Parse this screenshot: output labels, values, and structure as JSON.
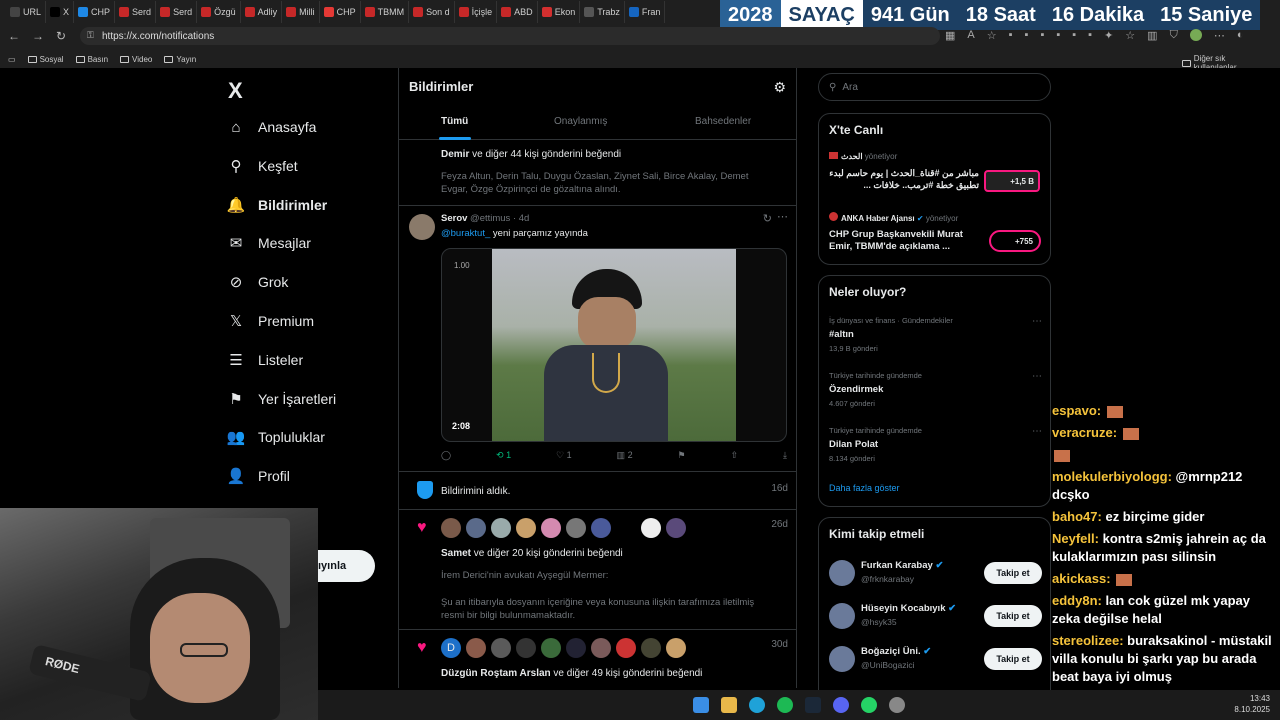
{
  "browser": {
    "tabs": [
      {
        "label": "URL",
        "color": "#444"
      },
      {
        "label": "X",
        "color": "#000"
      },
      {
        "label": "CHP",
        "color": "#1e88e5"
      },
      {
        "label": "Serd",
        "color": "#c62828"
      },
      {
        "label": "Serd",
        "color": "#c62828"
      },
      {
        "label": "Özgü",
        "color": "#c62828"
      },
      {
        "label": "Adliy",
        "color": "#c62828"
      },
      {
        "label": "Milli",
        "color": "#c62828"
      },
      {
        "label": "CHP",
        "color": "#e53935"
      },
      {
        "label": "TBMM",
        "color": "#c62828"
      },
      {
        "label": "Son d",
        "color": "#c62828"
      },
      {
        "label": "İçişle",
        "color": "#c62828"
      },
      {
        "label": "ABD",
        "color": "#c62828"
      },
      {
        "label": "Ekon",
        "color": "#d32f2f"
      },
      {
        "label": "Trabz",
        "color": "#555"
      },
      {
        "label": "Fran",
        "color": "#1565c0"
      }
    ],
    "url": "https://x.com/notifications",
    "bookmarks": [
      "Sosyal",
      "Basın",
      "Video",
      "Yayın"
    ],
    "other_bookmarks": "Diğer sık kullanılanlar"
  },
  "countdown": {
    "year": "2028",
    "label": "SAYAÇ",
    "days": "941 Gün",
    "hours": "18 Saat",
    "minutes": "16 Dakika",
    "seconds": "15 Saniye"
  },
  "sidebar": {
    "logo": "X",
    "items": [
      {
        "label": "Anasayfa",
        "icon": "home-icon",
        "glyph": "⌂"
      },
      {
        "label": "Keşfet",
        "icon": "search-icon",
        "glyph": "⚲"
      },
      {
        "label": "Bildirimler",
        "icon": "bell-icon",
        "glyph": "🔔"
      },
      {
        "label": "Mesajlar",
        "icon": "mail-icon",
        "glyph": "✉"
      },
      {
        "label": "Grok",
        "icon": "grok-icon",
        "glyph": "⊘"
      },
      {
        "label": "Premium",
        "icon": "x-premium-icon",
        "glyph": "𝕏"
      },
      {
        "label": "Listeler",
        "icon": "list-icon",
        "glyph": "☰"
      },
      {
        "label": "Yer İşaretleri",
        "icon": "bookmark-icon",
        "glyph": "⚑"
      },
      {
        "label": "Topluluklar",
        "icon": "communities-icon",
        "glyph": "👥"
      },
      {
        "label": "Profil",
        "icon": "profile-icon",
        "glyph": "👤"
      }
    ],
    "post_button": "ıyınla"
  },
  "main": {
    "title": "Bildirimler",
    "tabs": [
      "Tümü",
      "Onaylanmış",
      "Bahsedenler"
    ],
    "notif1": {
      "headline_name": "Demir",
      "headline_rest": " ve diğer 44 kişi gönderini beğendi",
      "text": "Feyza Altun, Derin Talu, Duygu Özaslan, Ziynet Sali, Birce Akalay, Demet Evgar, Özge Özpirinçci de gözaltına alındı."
    },
    "post": {
      "name": "Serov",
      "handle": "@ettimus · 4d",
      "mention": "@buraktut_",
      "text": " yeni parçamız yayında",
      "video_time": "2:08",
      "video_rate": "1.00",
      "retweets": "1",
      "likes": "1",
      "views": "2"
    },
    "notif2": {
      "text": "Bildirimini aldık.",
      "age": "16d"
    },
    "notif3": {
      "headline_name": "Samet",
      "headline_rest": " ve diğer 20 kişi gönderini beğendi",
      "age": "26d",
      "line1": "İrem Derici'nin avukatı Ayşegül Mermer:",
      "line2": "Şu an itibarıyla dosyanın içeriğine veya konusuna ilişkin tarafımıza iletilmiş resmi bir bilgi bulunmamaktadır."
    },
    "notif4": {
      "headline_name": "Düzgün Roştam Arslan",
      "headline_rest": " ve diğer 49 kişi gönderini beğendi",
      "age": "30d",
      "first_avatar_letter": "D"
    }
  },
  "right": {
    "search_placeholder": "Ara",
    "live": {
      "title": "X'te Canlı",
      "items": [
        {
          "host": "الحدث",
          "role": "yönetiyor",
          "text": "مباشر من #قناة_الحدث | يوم حاسم لبدء تطبيق خطة #ترمب.. خلافات ...",
          "count": "+1,5 B"
        },
        {
          "host": "ANKA Haber Ajansı",
          "role": "yönetiyor",
          "text": "CHP Grup Başkanvekili Murat Emir, TBMM'de açıklama ...",
          "count": "+755"
        }
      ]
    },
    "trends": {
      "title": "Neler oluyor?",
      "items": [
        {
          "meta": "İş dünyası ve finans · Gündemdekiler",
          "name": "#altın",
          "count": "13,9 B gönderi"
        },
        {
          "meta": "Türkiye tarihinde gündemde",
          "name": "Özendirmek",
          "count": "4.607 gönderi"
        },
        {
          "meta": "Türkiye tarihinde gündemde",
          "name": "Dilan Polat",
          "count": "8.134 gönderi"
        }
      ],
      "more": "Daha fazla göster"
    },
    "follow": {
      "title": "Kimi takip etmeli",
      "button": "Takip et",
      "items": [
        {
          "name": "Furkan Karabay",
          "handle": "@frkn​karabay"
        },
        {
          "name": "Hüseyin Kocabıyık",
          "handle": "@hsyk35"
        },
        {
          "name": "Boğaziçi Üni.",
          "handle": "@UniBogazici"
        }
      ]
    }
  },
  "chat": [
    {
      "user": "espavo:",
      "msg": ""
    },
    {
      "user": "veracruze:",
      "msg": ""
    },
    {
      "user": "",
      "msg": ""
    },
    {
      "user": "molekulerbiyologg:",
      "msg": "@mrnp212 dcşko"
    },
    {
      "user": "baho47:",
      "msg": "ez birçime gider"
    },
    {
      "user": "Neyfell:",
      "msg": "kontra s2miş jahrein aç da kulaklarımızın pası silinsin"
    },
    {
      "user": "akickass:",
      "msg": ""
    },
    {
      "user": "eddy8n:",
      "msg": "lan cok güzel mk yapay zeka değilse helal"
    },
    {
      "user": "stereolizee:",
      "msg": "buraksakinol - müstakil villa konulu bi şarkı yap bu arada beat baya iyi olmuş"
    }
  ],
  "webcam": {
    "mic_brand": "RØDE"
  },
  "clock": {
    "time": "13:43",
    "date": "8.10.2025"
  }
}
